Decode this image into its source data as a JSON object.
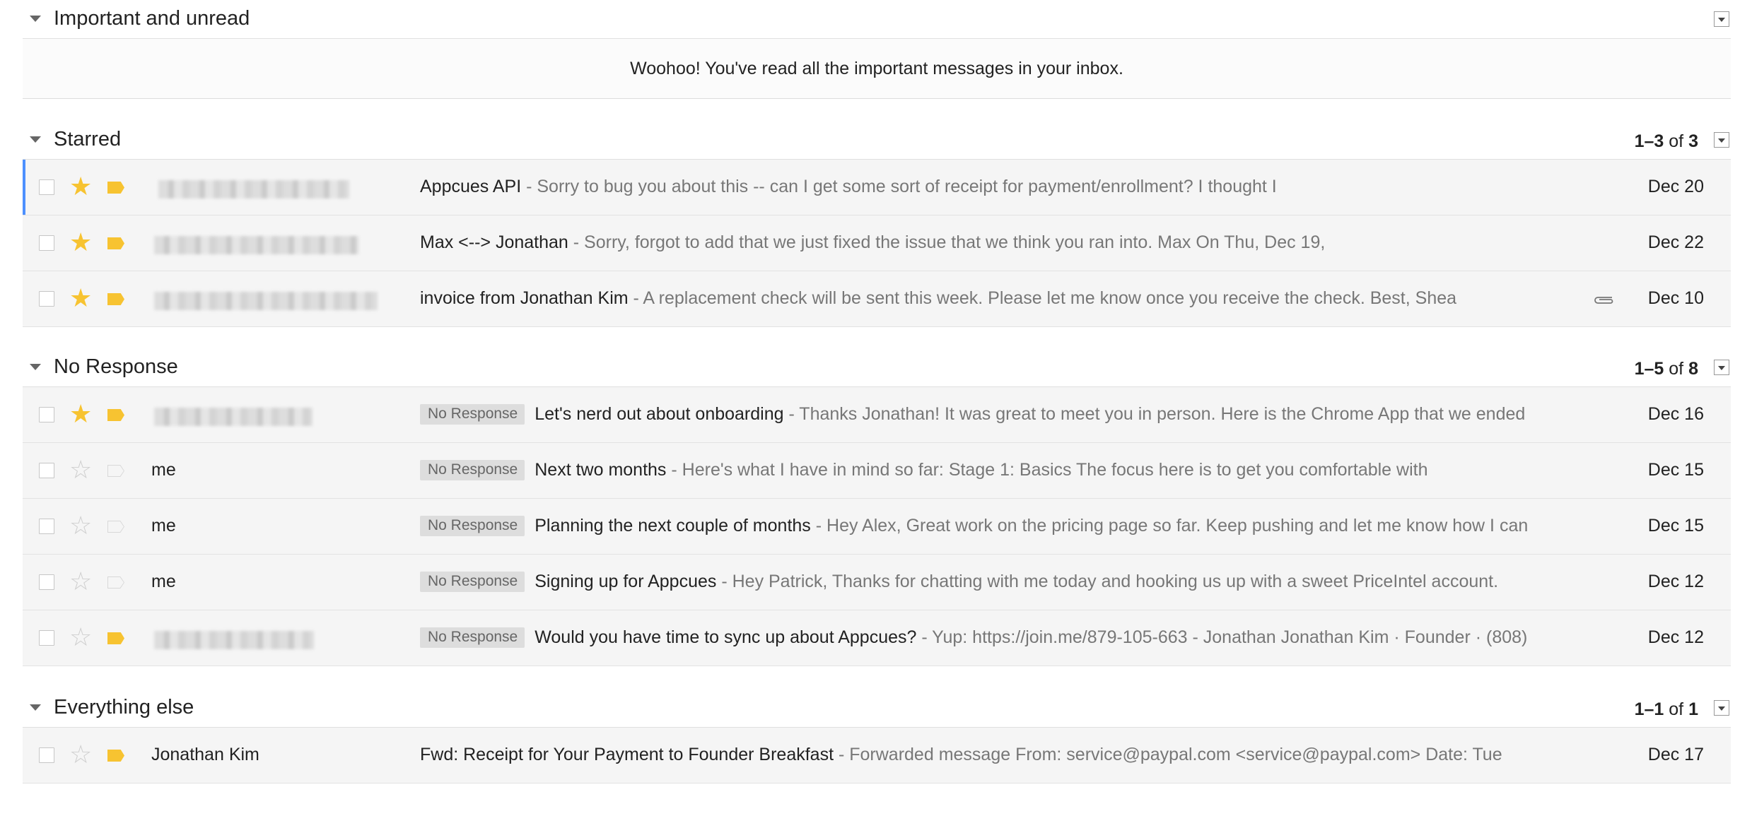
{
  "sections": {
    "important": {
      "title": "Important and unread",
      "empty_message": "Woohoo! You've read all the important messages in your inbox."
    },
    "starred": {
      "title": "Starred",
      "range": "1–3",
      "of": "of",
      "total": "3",
      "rows": [
        {
          "subject": "Appcues API",
          "snippet": " - Sorry to bug you about this -- can I get some sort of receipt for payment/enrollment? I thought I",
          "date": "Dec 20"
        },
        {
          "subject": "Max <--> Jonathan",
          "snippet": " - Sorry, forgot to add that we just fixed the issue that we think you ran into. Max On Thu, Dec 19,",
          "date": "Dec 22"
        },
        {
          "subject": "invoice from Jonathan Kim",
          "snippet": " - A replacement check will be sent this week. Please let me know once you receive the check. Best, Shea",
          "date": "Dec 10"
        }
      ]
    },
    "no_response": {
      "title": "No Response",
      "range": "1–5",
      "of": "of",
      "total": "8",
      "label": "No Response",
      "rows": [
        {
          "sender": "",
          "subject": "Let's nerd out about onboarding",
          "snippet": " - Thanks Jonathan! It was great to meet you in person. Here is the Chrome App that we ended",
          "date": "Dec 16"
        },
        {
          "sender": "me",
          "subject": "Next two months",
          "snippet": " - Here's what I have in mind so far: Stage 1: Basics The focus here is to get you comfortable with",
          "date": "Dec 15"
        },
        {
          "sender": "me",
          "subject": "Planning the next couple of months",
          "snippet": " - Hey Alex, Great work on the pricing page so far. Keep pushing and let me know how I can",
          "date": "Dec 15"
        },
        {
          "sender": "me",
          "subject": "Signing up for Appcues",
          "snippet": " - Hey Patrick, Thanks for chatting with me today and hooking us up with a sweet PriceIntel account.",
          "date": "Dec 12"
        },
        {
          "sender": "",
          "subject": "Would you have time to sync up about Appcues?",
          "snippet": " - Yup: https://join.me/879-105-663 - Jonathan Jonathan Kim · Founder · (808)",
          "date": "Dec 12"
        }
      ]
    },
    "everything_else": {
      "title": "Everything else",
      "range": "1–1",
      "of": "of",
      "total": "1",
      "rows": [
        {
          "sender": "Jonathan Kim",
          "subject": "Fwd: Receipt for Your Payment to Founder Breakfast",
          "snippet": " -  Forwarded message From: service@paypal.com <service@paypal.com> Date: Tue",
          "date": "Dec 17"
        }
      ]
    }
  },
  "colors": {
    "star_on": "#f7c331",
    "focus_bar": "#4d90fe",
    "row_bg": "#f5f5f5"
  },
  "icons": [
    "dropdown-triangle-icon",
    "star-icon",
    "label-tag-icon",
    "attachment-paperclip-icon",
    "section-menu-icon"
  ]
}
